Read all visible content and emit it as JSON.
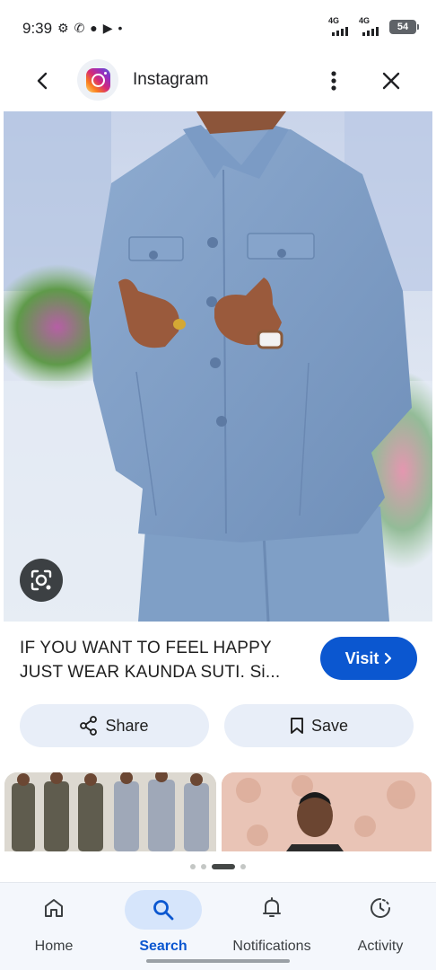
{
  "status_bar": {
    "time": "9:39",
    "network_1": "4G",
    "network_2": "4G",
    "battery": "54"
  },
  "header": {
    "title": "Instagram",
    "icons": [
      "back-arrow-icon",
      "instagram-logo-icon",
      "more-vert-icon",
      "close-icon"
    ]
  },
  "result": {
    "caption_line1": "IF YOU WANT TO FEEL HAPPY",
    "caption_line2": "JUST WEAR KAUNDA SUTI. Si...",
    "visit_label": "Visit",
    "share_label": "Share",
    "save_label": "Save"
  },
  "pager": {
    "count": 4,
    "active_index": 2
  },
  "bottom_nav": {
    "items": [
      {
        "label": "Home",
        "icon": "home-icon",
        "active": false
      },
      {
        "label": "Search",
        "icon": "search-icon",
        "active": true
      },
      {
        "label": "Notifications",
        "icon": "bell-icon",
        "active": false
      },
      {
        "label": "Activity",
        "icon": "activity-icon",
        "active": false
      }
    ]
  },
  "colors": {
    "accent": "#0b57d0",
    "pill_bg": "#e8eef8",
    "suit_blue": "#7f9fc6"
  }
}
